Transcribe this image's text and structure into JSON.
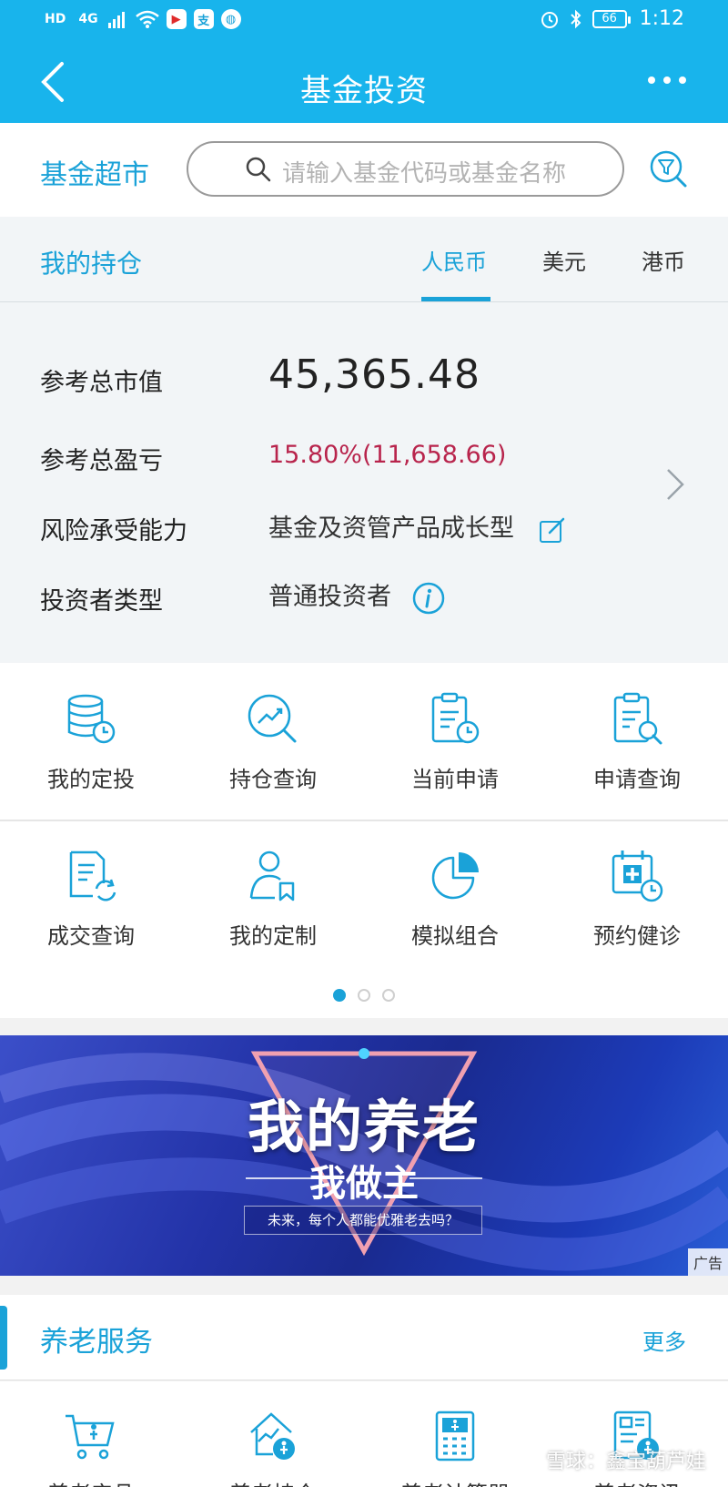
{
  "status_bar": {
    "left_icons": [
      "HD",
      "4G",
      "signal-icon",
      "wifi-icon",
      "app-icon",
      "alipay-icon",
      "voice-icon"
    ],
    "hd": "HD",
    "net": "4G",
    "battery": "66",
    "time": "1:12"
  },
  "nav": {
    "title": "基金投资"
  },
  "search": {
    "market_label": "基金超市",
    "placeholder": "请输入基金代码或基金名称"
  },
  "holdings": {
    "title": "我的持仓",
    "tabs": [
      {
        "label": "人民币",
        "active": true
      },
      {
        "label": "美元",
        "active": false
      },
      {
        "label": "港币",
        "active": false
      }
    ],
    "rows": {
      "market_value_label": "参考总市值",
      "market_value": "45,365.48",
      "profit_label": "参考总盈亏",
      "profit": "15.80%(11,658.66)",
      "risk_label": "风险承受能力",
      "risk": "基金及资管产品成长型",
      "investor_label": "投资者类型",
      "investor": "普通投资者"
    }
  },
  "grid": {
    "items": [
      {
        "label": "我的定投",
        "icon": "database-clock-icon"
      },
      {
        "label": "持仓查询",
        "icon": "trend-search-icon"
      },
      {
        "label": "当前申请",
        "icon": "clipboard-clock-icon"
      },
      {
        "label": "申请查询",
        "icon": "clipboard-search-icon"
      },
      {
        "label": "成交查询",
        "icon": "document-refresh-icon"
      },
      {
        "label": "我的定制",
        "icon": "person-bookmark-icon"
      },
      {
        "label": "模拟组合",
        "icon": "pie-chart-icon"
      },
      {
        "label": "预约健诊",
        "icon": "calendar-plus-icon"
      }
    ],
    "page_count": 3,
    "current_page": 1
  },
  "banner": {
    "title": "我的养老",
    "subtitle": "我做主",
    "note": "未来，每个人都能优雅老去吗？",
    "ad_label": "广告"
  },
  "pension": {
    "title": "养老服务",
    "more": "更多",
    "items": [
      {
        "label": "养老产品",
        "icon": "cart-elder-icon"
      },
      {
        "label": "养老持仓",
        "icon": "house-elder-icon"
      },
      {
        "label": "养老计算器",
        "icon": "calculator-elder-icon"
      },
      {
        "label": "养老资讯",
        "icon": "news-elder-icon"
      }
    ]
  },
  "watermark": "雪球：鑫宝葫芦娃",
  "colors": {
    "primary": "#18b4ec",
    "accent": "#1aa2d8",
    "profit": "#b8244c"
  }
}
